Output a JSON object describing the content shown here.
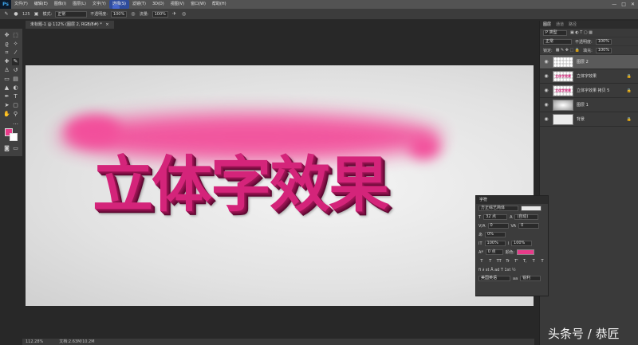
{
  "menu": {
    "logo": "Ps",
    "items": [
      "文件(F)",
      "编辑(E)",
      "图像(I)",
      "图层(L)",
      "文字(Y)",
      "选择(S)",
      "滤镜(T)",
      "3D(D)",
      "视图(V)",
      "窗口(W)",
      "帮助(H)"
    ],
    "active_index": 5,
    "window_controls": [
      "—",
      "□",
      "✕"
    ]
  },
  "options": {
    "brush_size": "125",
    "mode_label": "模式:",
    "mode_value": "正常",
    "opacity_label": "不透明度:",
    "opacity_value": "100%",
    "flow_label": "流量:",
    "flow_value": "100%"
  },
  "document_tab": {
    "title": "未标题-1 @ 112% (图层 2, RGB/8#) *",
    "close": "×"
  },
  "canvas": {
    "text": "立体字效果",
    "colors": {
      "face": "#d4247a",
      "glow": "#f24f9b",
      "swatch_fg": "#e83b8a",
      "swatch_bg": "#ffffff"
    }
  },
  "status": {
    "zoom": "112.28%",
    "doc": "文档:2.63M/10.2M"
  },
  "layers_panel": {
    "tabs": [
      "图层",
      "通道",
      "路径"
    ],
    "kind_filter": "P 类型",
    "blend_mode": "正常",
    "opacity_label": "不透明度:",
    "opacity_value": "100%",
    "lock_label": "锁定:",
    "fill_label": "填充:",
    "fill_value": "100%",
    "layers": [
      {
        "name": "图层 2",
        "thumb": "",
        "selected": true,
        "locked": false
      },
      {
        "name": "立体字效果",
        "thumb": "立体字效果",
        "selected": false,
        "locked": true
      },
      {
        "name": "立体字效果 拷贝 5",
        "thumb": "立体字效果",
        "selected": false,
        "locked": true
      },
      {
        "name": "图层 1",
        "thumb": "",
        "selected": false,
        "locked": false
      },
      {
        "name": "背景",
        "thumb": "",
        "selected": false,
        "locked": true
      }
    ]
  },
  "char_panel": {
    "title": "字符",
    "font": "方正综艺简体",
    "size": "32 点",
    "leading": "(自动)",
    "kerning": "0",
    "tracking": "0",
    "scale_pct": "0%",
    "vscale": "100%",
    "hscale": "100%",
    "baseline": "0 点",
    "color_label": "颜色:",
    "style_buttons": [
      "T",
      "T",
      "TT",
      "Tr",
      "T'",
      "T,",
      "T",
      "T"
    ],
    "lang": "美国英语",
    "aa_label": "aa",
    "aa_value": "锐利"
  },
  "watermark": "头条号 / 恭匠"
}
